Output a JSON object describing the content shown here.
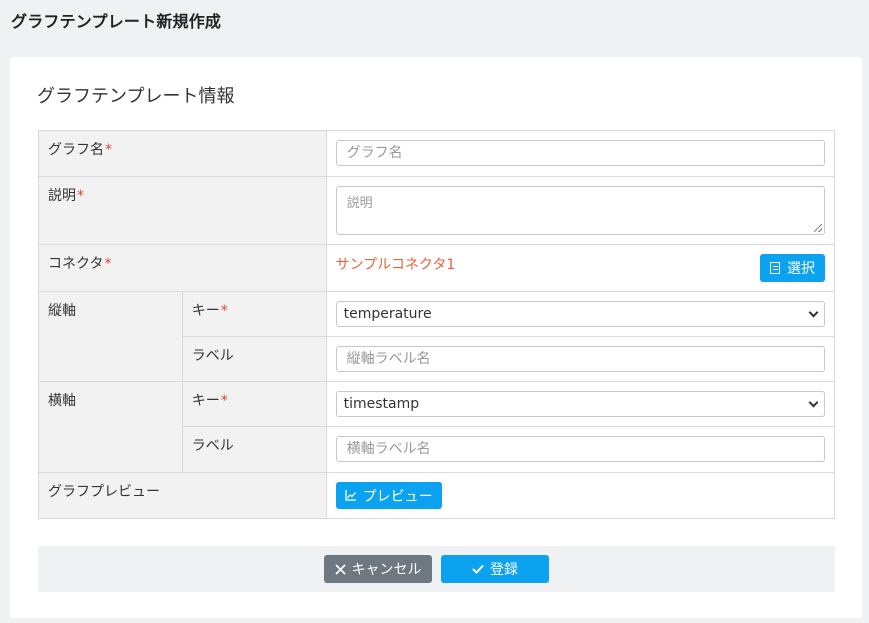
{
  "header": {
    "title": "グラフテンプレート新規作成"
  },
  "section": {
    "title": "グラフテンプレート情報"
  },
  "required_mark": "*",
  "form": {
    "graph_name": {
      "label": "グラフ名",
      "placeholder": "グラフ名"
    },
    "description": {
      "label": "説明",
      "placeholder": "説明"
    },
    "connector": {
      "label": "コネクタ",
      "value": "サンプルコネクタ1",
      "select_button": "選択"
    },
    "y_axis": {
      "label": "縦軸",
      "key_label": "キー",
      "key_value": "temperature",
      "label_label": "ラベル",
      "label_placeholder": "縦軸ラベル名"
    },
    "x_axis": {
      "label": "横軸",
      "key_label": "キー",
      "key_value": "timestamp",
      "label_label": "ラベル",
      "label_placeholder": "横軸ラベル名"
    },
    "preview": {
      "label": "グラフプレビュー",
      "button": "プレビュー"
    }
  },
  "footer": {
    "cancel": "キャンセル",
    "submit": "登録"
  },
  "colors": {
    "accent": "#0ba2f0",
    "connector_text": "#e8643c",
    "required": "#e0413a",
    "cancel": "#6d7880"
  },
  "icons": {
    "select": "list-icon",
    "preview": "chart-line-icon",
    "cancel": "close-icon",
    "submit": "check-icon"
  }
}
